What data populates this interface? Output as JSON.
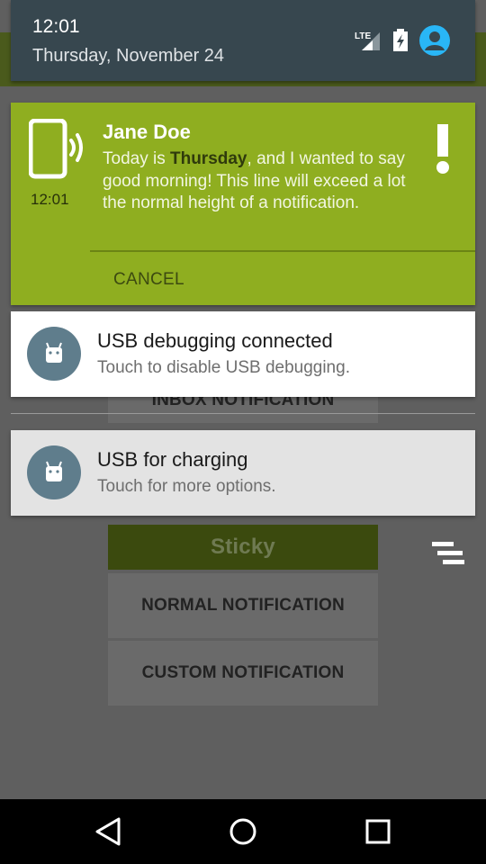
{
  "status_header": {
    "time": "12:01",
    "date": "Thursday, November 24",
    "icons": [
      "lte-signal-icon",
      "battery-charging-icon",
      "user-avatar-icon"
    ],
    "lte_label": "LTE",
    "accent_color": "#29b6f6"
  },
  "notifications": {
    "jane": {
      "title": "Jane Doe",
      "time": "12:01",
      "body_prefix": "Today is ",
      "body_bold": "Thursday",
      "body_suffix": ", and I wanted to say good morning! This line will exceed a lot the normal height of a notification.",
      "action_label": "CANCEL",
      "background_color": "#8fae20"
    },
    "usb_debugging": {
      "title": "USB debugging connected",
      "subtitle": "Touch to disable USB debugging.",
      "icon": "android-icon"
    },
    "usb_charging": {
      "title": "USB for charging",
      "subtitle": "Touch for more options.",
      "icon": "android-icon"
    }
  },
  "app": {
    "buttons": {
      "inbox": "INBOX NOTIFICATION",
      "sticky": "Sticky",
      "normal": "NORMAL NOTIFICATION",
      "custom": "CUSTOM NOTIFICATION"
    }
  },
  "nav": {
    "icons": [
      "back-icon",
      "home-icon",
      "recents-icon"
    ]
  }
}
